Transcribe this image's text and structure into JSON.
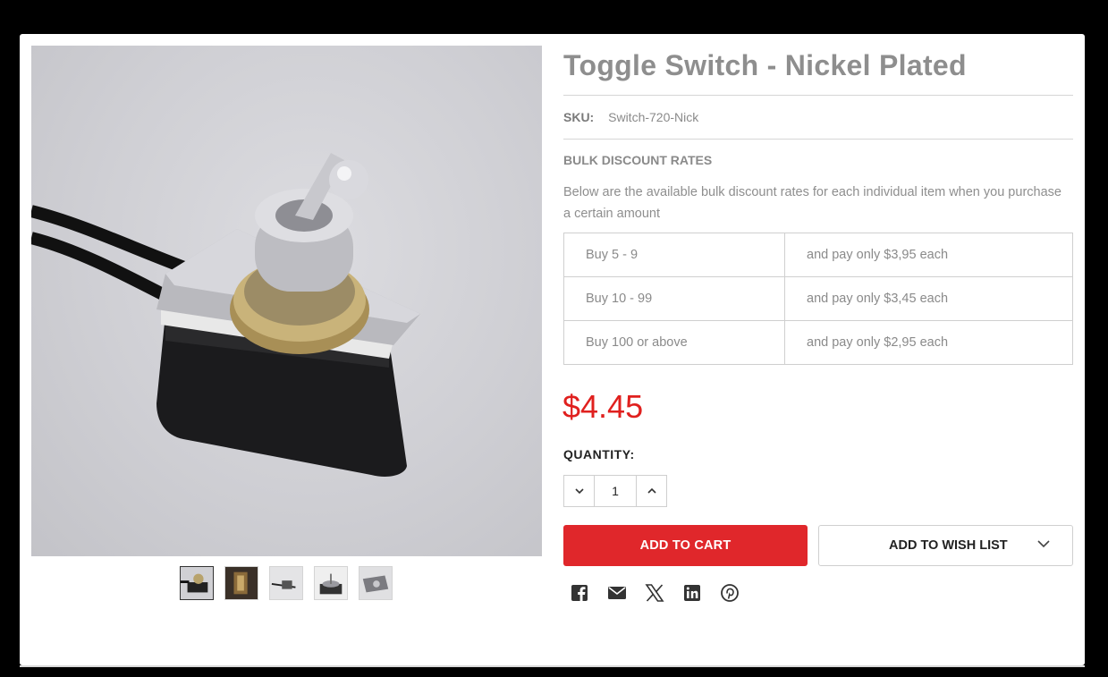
{
  "product": {
    "title": "Toggle Switch - Nickel Plated",
    "sku_label": "SKU:",
    "sku_value": "Switch-720-Nick",
    "price": "$4.45",
    "price_color": "#e0201e"
  },
  "bulk": {
    "title": "BULK DISCOUNT RATES",
    "description": "Below are the available bulk discount rates for each individual item when you purchase a certain amount",
    "rows": [
      {
        "qty": "Buy 5 - 9",
        "price": "and pay only $3,95 each"
      },
      {
        "qty": "Buy 10 - 99",
        "price": "and pay only $3,45 each"
      },
      {
        "qty": "Buy 100 or above",
        "price": "and pay only $2,95 each"
      }
    ]
  },
  "quantity": {
    "label": "QUANTITY:",
    "value": "1"
  },
  "buttons": {
    "add_to_cart": "ADD TO CART",
    "add_to_wish_list": "ADD TO WISH LIST",
    "cart_color": "#e0272b"
  },
  "gallery": {
    "main_image": "toggle-switch-photo",
    "thumbnail_count": 5,
    "active_thumbnail": 1
  },
  "social": [
    "facebook-icon",
    "email-icon",
    "x-icon",
    "linkedin-icon",
    "pinterest-icon"
  ]
}
